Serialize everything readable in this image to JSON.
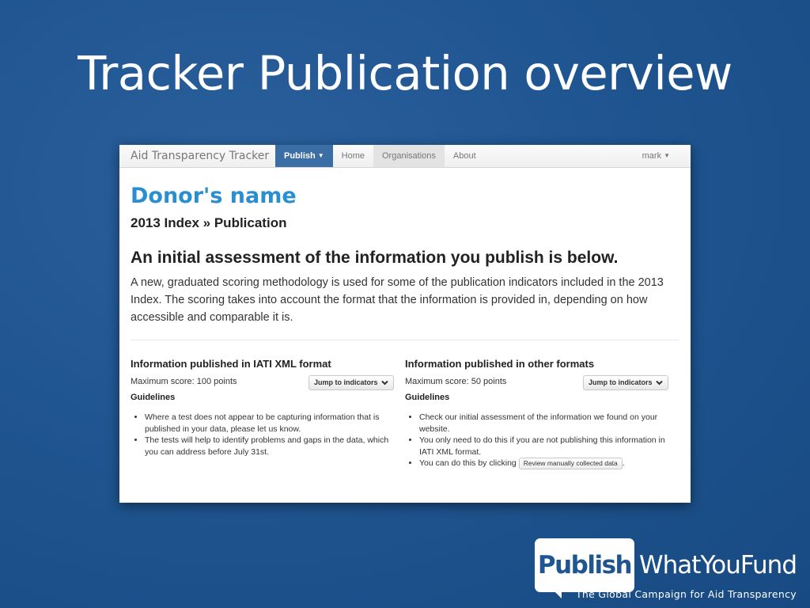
{
  "slide": {
    "title": "Tracker Publication overview"
  },
  "navbar": {
    "brand": "Aid Transparency Tracker",
    "items": [
      {
        "label": "Publish",
        "caret": "▼"
      },
      {
        "label": "Home"
      },
      {
        "label": "Organisations"
      },
      {
        "label": "About"
      }
    ],
    "user": {
      "label": "mark",
      "caret": "▼"
    }
  },
  "page": {
    "donor_name": "Donor's name",
    "breadcrumb": "2013 Index » Publication",
    "lead": "An initial assessment of the information you publish is below.",
    "description": "A new, graduated scoring methodology is used for some of the publication indicators included in the 2013 Index. The scoring takes into account the format that the information is provided in, depending on how accessible and comparable it is."
  },
  "columns": [
    {
      "heading": "Information published in IATI XML format",
      "max_score": "Maximum score: 100 points",
      "jump_label": "Jump to indicators",
      "guidelines_heading": "Guidelines",
      "guidelines": [
        "Where a test does not appear to be capturing information that is published in your data, please let us know.",
        "The tests will help to identify problems and gaps in the data, which you can address before July 31st."
      ]
    },
    {
      "heading": "Information published in other formats",
      "max_score": "Maximum score: 50 points",
      "jump_label": "Jump to indicators",
      "guidelines_heading": "Guidelines",
      "guidelines": [
        "Check our initial assessment of the information we found on your website.",
        "You only need to do this if you are not publishing this information in IATI XML format."
      ],
      "last_guideline_prefix": "You can do this by clicking",
      "review_button_label": "Review manually collected data",
      "last_guideline_suffix": "."
    }
  ],
  "logo": {
    "box_text": "Publish",
    "word": "WhatYouFund",
    "tagline": "The Global Campaign for Aid Transparency"
  },
  "colors": {
    "background": "#1f5590",
    "nav_active": "#3b6ea5",
    "donor_name": "#2a8fd0"
  }
}
